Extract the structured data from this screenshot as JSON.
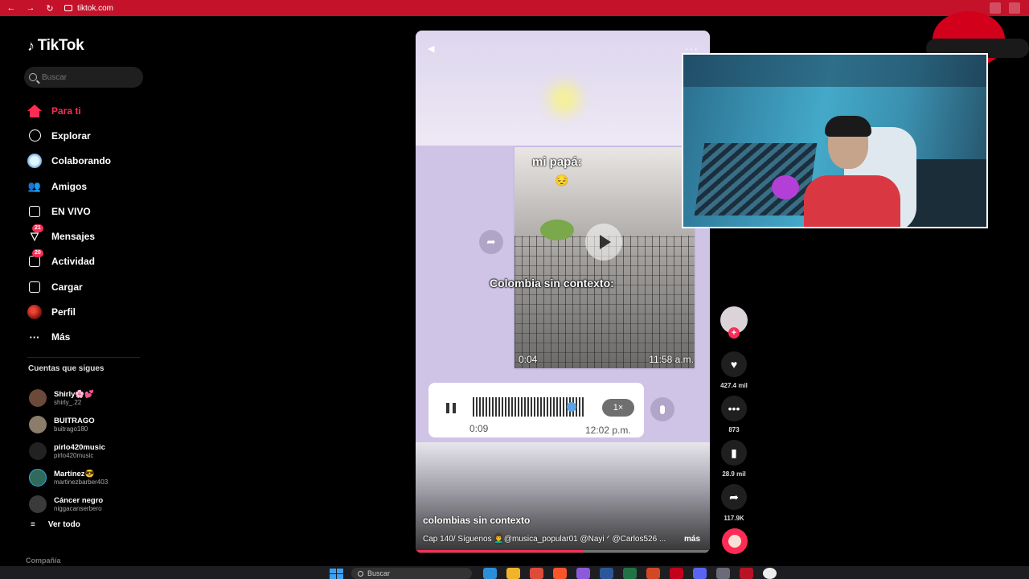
{
  "browser": {
    "url": "tiktok.com"
  },
  "sidebar": {
    "logo": "TikTok",
    "search_placeholder": "Buscar",
    "nav": [
      {
        "label": "Para ti",
        "icon": "home-icon",
        "active": true
      },
      {
        "label": "Explorar",
        "icon": "compass-icon"
      },
      {
        "label": "Colaborando",
        "icon": "collab-icon"
      },
      {
        "label": "Amigos",
        "icon": "friends-icon"
      },
      {
        "label": "EN VIVO",
        "icon": "live-tv-icon"
      },
      {
        "label": "Mensajes",
        "icon": "messages-icon",
        "badge": "21"
      },
      {
        "label": "Actividad",
        "icon": "activity-icon",
        "badge": "20"
      },
      {
        "label": "Cargar",
        "icon": "upload-icon"
      },
      {
        "label": "Perfil",
        "icon": "profile-icon"
      },
      {
        "label": "Más",
        "icon": "more-icon"
      }
    ],
    "following_title": "Cuentas que sigues",
    "following": [
      {
        "name": "Shirly🌸💕",
        "user": "shirly_.22"
      },
      {
        "name": "BUITRAGO",
        "user": "buitrago180"
      },
      {
        "name": "pirlo420music",
        "user": "pirlo420music"
      },
      {
        "name": "Martínez😎",
        "user": "martinezbarber403"
      },
      {
        "name": "Cáncer negro",
        "user": "niggacanserbero"
      }
    ],
    "see_all": "Ver todo",
    "company": "Compañía"
  },
  "video": {
    "caption_top": "mi papá:",
    "caption_emoji": "😔",
    "caption_mid": "Colombia sin contexto:",
    "media_duration": "0:04",
    "media_time": "11:58 a.m.",
    "audio_duration": "0:09",
    "audio_time": "12:02 p.m.",
    "audio_speed": "1×",
    "author": "colombias sin contexto",
    "description": "Cap 140/ Síguenos 👨‍🦱@musica_popular01 @Nayi ᐟ  @Carlos526 ...",
    "more": "más",
    "progress": 0.57
  },
  "actions": {
    "likes": "427.4 mil",
    "comments": "873",
    "saves": "28.9 mil",
    "shares": "117.9K"
  },
  "taskbar": {
    "search": "Buscar"
  },
  "colors": {
    "accent": "#fe2c55",
    "browser_bar": "#c3122a"
  }
}
